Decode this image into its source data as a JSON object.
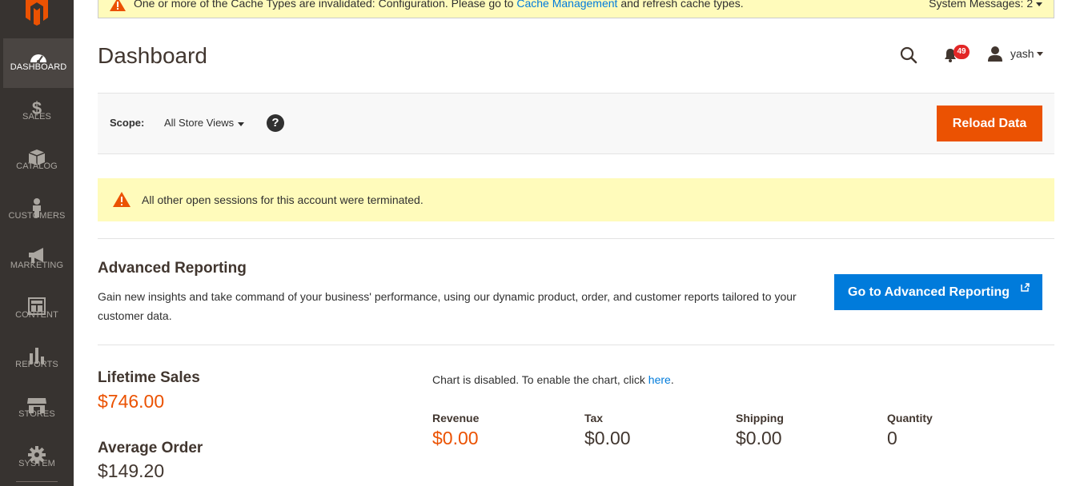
{
  "system_message": {
    "text_before": "One or more of the Cache Types are invalidated: Configuration. Please go to",
    "link": "Cache Management",
    "text_after": "and refresh cache types.",
    "count_label": "System Messages: 2"
  },
  "sidebar": {
    "items": [
      {
        "label": "DASHBOARD",
        "icon": "dashboard-icon",
        "active": true
      },
      {
        "label": "SALES",
        "icon": "dollar-icon"
      },
      {
        "label": "CATALOG",
        "icon": "box-icon"
      },
      {
        "label": "CUSTOMERS",
        "icon": "person-icon"
      },
      {
        "label": "MARKETING",
        "icon": "megaphone-icon"
      },
      {
        "label": "CONTENT",
        "icon": "layout-icon"
      },
      {
        "label": "REPORTS",
        "icon": "bar-chart-icon"
      },
      {
        "label": "STORES",
        "icon": "storefront-icon"
      },
      {
        "label": "SYSTEM",
        "icon": "gear-icon"
      }
    ]
  },
  "header": {
    "title": "Dashboard",
    "notification_count": "49",
    "user_name": "yash"
  },
  "scope": {
    "label": "Scope:",
    "value": "All Store Views",
    "help": "?",
    "reload_label": "Reload Data"
  },
  "info_message": "All other open sessions for this account were terminated.",
  "advanced_reporting": {
    "title": "Advanced Reporting",
    "description": "Gain new insights and take command of your business' performance, using our dynamic product, order, and customer reports tailored to your customer data.",
    "button_label": "Go to Advanced Reporting"
  },
  "totals": {
    "lifetime_sales_label": "Lifetime Sales",
    "lifetime_sales_value": "$746.00",
    "average_order_label": "Average Order",
    "average_order_value": "$149.20"
  },
  "chart_note": {
    "text": "Chart is disabled. To enable the chart, click",
    "link": "here",
    "suffix": "."
  },
  "metrics": {
    "revenue_label": "Revenue",
    "revenue_value": "$0.00",
    "tax_label": "Tax",
    "tax_value": "$0.00",
    "shipping_label": "Shipping",
    "shipping_value": "$0.00",
    "quantity_label": "Quantity",
    "quantity_value": "0"
  },
  "colors": {
    "accent_orange": "#eb5202",
    "link_blue": "#007bdb",
    "sidebar_bg": "#373330",
    "message_bg": "#fffbbb"
  }
}
